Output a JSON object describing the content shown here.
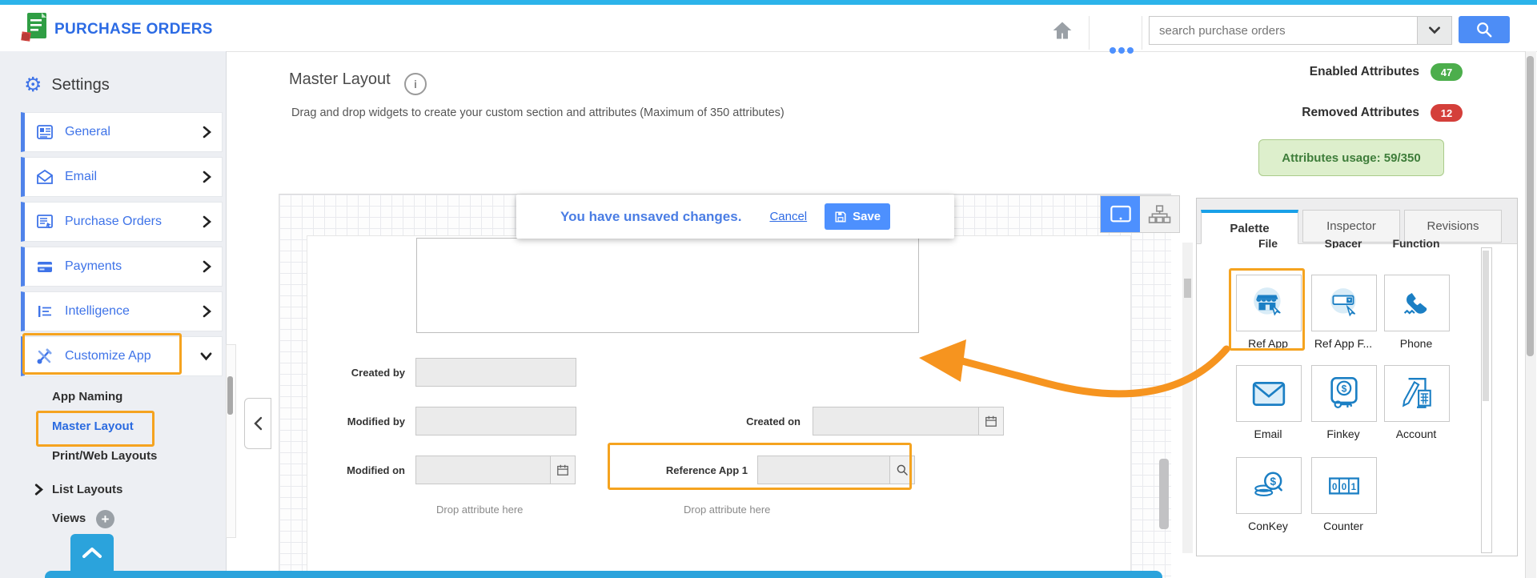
{
  "colors": {
    "topbar_cyan": "#2cb3ea",
    "accent_blue": "#3e73e8",
    "action_blue": "#4d90fe",
    "palette_icon_blue": "#1b7fc4",
    "highlight_orange": "#f5a31f",
    "success_green": "#4cae4c",
    "danger_red": "#d43f3a",
    "usage_green_bg": "#ddefcc",
    "usage_green_text": "#3e7d3a",
    "bottom_bar_blue": "#2ba3dc"
  },
  "header": {
    "app_title": "PURCHASE ORDERS",
    "search_placeholder": "search purchase orders"
  },
  "icons": {
    "logo": "green-document-with-red-cube",
    "home": "house",
    "more": "three-blue-dots",
    "search": "magnifier",
    "settings": "gear",
    "save": "floppy-disk",
    "calendar": "calendar-grid",
    "monitor_view": "tablet-screen",
    "layout_view": "sitemap"
  },
  "sidebar": {
    "title": "Settings",
    "items": [
      {
        "label": "General"
      },
      {
        "label": "Email"
      },
      {
        "label": "Purchase Orders"
      },
      {
        "label": "Payments"
      },
      {
        "label": "Intelligence"
      },
      {
        "label": "Customize App"
      }
    ],
    "subitems": [
      {
        "label": "App Naming"
      },
      {
        "label": "Master Layout"
      },
      {
        "label": "Print/Web Layouts"
      },
      {
        "label": "List Layouts"
      },
      {
        "label": "Views"
      }
    ]
  },
  "page": {
    "title": "Master Layout",
    "description": "Drag and drop widgets to create your custom section and attributes (Maximum of 350 attributes)",
    "stats": {
      "enabled_label": "Enabled Attributes",
      "enabled_value": "47",
      "removed_label": "Removed Attributes",
      "removed_value": "12",
      "usage_label": "Attributes usage: 59/350"
    }
  },
  "banner": {
    "message": "You have unsaved changes.",
    "cancel_label": "Cancel",
    "save_label": "Save"
  },
  "form": {
    "fields": [
      {
        "label": "Created by"
      },
      {
        "label": "Modified by"
      },
      {
        "label": "Created on"
      },
      {
        "label": "Modified on"
      },
      {
        "label": "Reference App 1"
      }
    ],
    "drop_hint_left": "Drop attribute here",
    "drop_hint_right": "Drop attribute here"
  },
  "palette": {
    "tabs": [
      {
        "label": "Palette"
      },
      {
        "label": "Inspector"
      },
      {
        "label": "Revisions"
      }
    ],
    "clipped_labels": [
      {
        "label": "File"
      },
      {
        "label": "Spacer"
      },
      {
        "label": "Function"
      }
    ],
    "widgets": [
      {
        "label": "Ref App"
      },
      {
        "label": "Ref App F..."
      },
      {
        "label": "Phone"
      },
      {
        "label": "Email"
      },
      {
        "label": "Finkey"
      },
      {
        "label": "Account"
      },
      {
        "label": "ConKey"
      },
      {
        "label": "Counter"
      }
    ],
    "glyphs": {
      "dollar": "$",
      "d0": "0",
      "d1": "1"
    }
  }
}
